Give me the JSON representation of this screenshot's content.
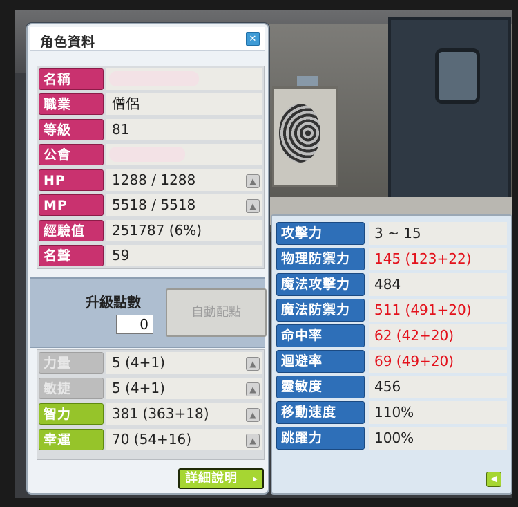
{
  "window": {
    "title": "角色資料",
    "close_icon": "close-icon"
  },
  "info": {
    "name_label": "名稱",
    "job_label": "職業",
    "job_value": "僧侶",
    "level_label": "等級",
    "level_value": "81",
    "guild_label": "公會",
    "hp_label": "HP",
    "hp_value": "1288 / 1288",
    "mp_label": "MP",
    "mp_value": "5518 / 5518",
    "exp_label": "經驗值",
    "exp_value": "251787 (6%)",
    "fame_label": "名聲",
    "fame_value": "59"
  },
  "points": {
    "label": "升級點數",
    "value": "0",
    "auto_button": "自動配點"
  },
  "stats": {
    "str_label": "力量",
    "str_value": "5 (4+1)",
    "dex_label": "敏捷",
    "dex_value": "5 (4+1)",
    "int_label": "智力",
    "int_value": "381 (363+18)",
    "luk_label": "幸運",
    "luk_value": "70 (54+16)"
  },
  "detail_button": "詳細說明",
  "detail": {
    "atk_label": "攻擊力",
    "atk_value": "3 ~ 15",
    "pdef_label": "物理防禦力",
    "pdef_value": "145 (123+22)",
    "matk_label": "魔法攻擊力",
    "matk_value": "484",
    "mdef_label": "魔法防禦力",
    "mdef_value": "511 (491+20)",
    "acc_label": "命中率",
    "acc_value": "62 (42+20)",
    "avoid_label": "迴避率",
    "avoid_value": "69 (49+20)",
    "hands_label": "靈敏度",
    "hands_value": "456",
    "speed_label": "移動速度",
    "speed_value": "110%",
    "jump_label": "跳躍力",
    "jump_value": "100%"
  },
  "colors": {
    "label_pink": "#c9326f",
    "label_blue": "#2e6fb8",
    "label_green": "#96c42a",
    "value_red": "#e3121c"
  }
}
